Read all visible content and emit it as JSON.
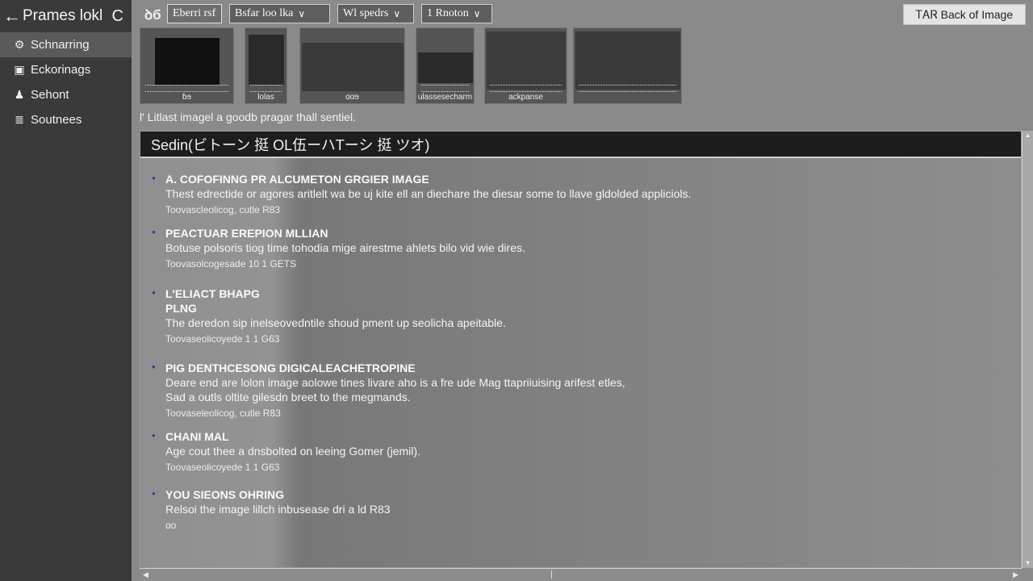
{
  "sidebar": {
    "title": "Prames lokl",
    "extra": "C",
    "items": [
      {
        "label": "Schnarring",
        "icon": "gear-icon",
        "active": true
      },
      {
        "label": "Eckorinags",
        "icon": "folder-icon",
        "active": false
      },
      {
        "label": "Sehont",
        "icon": "person-icon",
        "active": false
      },
      {
        "label": "Soutnees",
        "icon": "document-icon",
        "active": false
      }
    ]
  },
  "toolbar": {
    "logo": "ꝺб",
    "selected_label": "Eberri rsf",
    "dropdowns": [
      "Bsfar loo lka",
      "Wl spedrs",
      "1 Rnoton"
    ],
    "back_label": "ᎢᎪᏒ Back of Image"
  },
  "thumbnails": [
    {
      "caption": "ɓɘ"
    },
    {
      "caption": "lolas"
    },
    {
      "caption": "ɑɑɘ"
    },
    {
      "caption": "ulassesecharm"
    },
    {
      "caption": "ackpanse"
    },
    {
      "caption": ""
    }
  ],
  "caption_line": "l' Litlast imagel a goodb pragar thall sentiel.",
  "panel": {
    "title": "Sedin(ビトーン 挺 OL伍ーハTーシ 挺 ツオ)",
    "entries": [
      {
        "heading": "A. COFOFINNG PR ALCUMETON GRGIER IMAGE",
        "lines": [
          "Thest edrectide or agores aritlelt wa be uj kite ell an diechare the diesar some to llave gldolded appliciols."
        ],
        "meta": "Toovascleolicog, cutle R83"
      },
      {
        "heading": "PEACTUAR EREPION MLLIAN",
        "lines": [
          "Botuse polsoris tiog time tohodia mige airestme ahlets bilo vid wie dires."
        ],
        "meta": "Toovasolcogesade 10 1 GETS"
      },
      {
        "heading": "L'ELIACT BHAPG\nPLNG",
        "lines": [
          "The deredon sip inelseovedntile shoud pment up seolicha apeitable."
        ],
        "meta": "Toovaseolicoyede 1 1 G63"
      },
      {
        "heading": "PIG DENTHCESONG DIGICALEACHETROPINE",
        "lines": [
          "Deare end are lolon image aolowe tines livare aho is a fre ude Mag ttapriiuising arifest etles,",
          "Sad a outls oltite gilesdn breet to the megmands."
        ],
        "meta": "Toovaseleolicog, cutle R83"
      },
      {
        "heading": "CHANI MAL",
        "lines": [
          "Age cout thee a dnsbolted on leeing Gomer (jemil)."
        ],
        "meta": "Toovaseolicoyede 1 1 G63"
      },
      {
        "heading": "YOU SIEONS OHRING",
        "lines": [
          "Relsoi the image lillch inbusease dri a ld R83"
        ],
        "meta": "ɑo"
      }
    ]
  }
}
